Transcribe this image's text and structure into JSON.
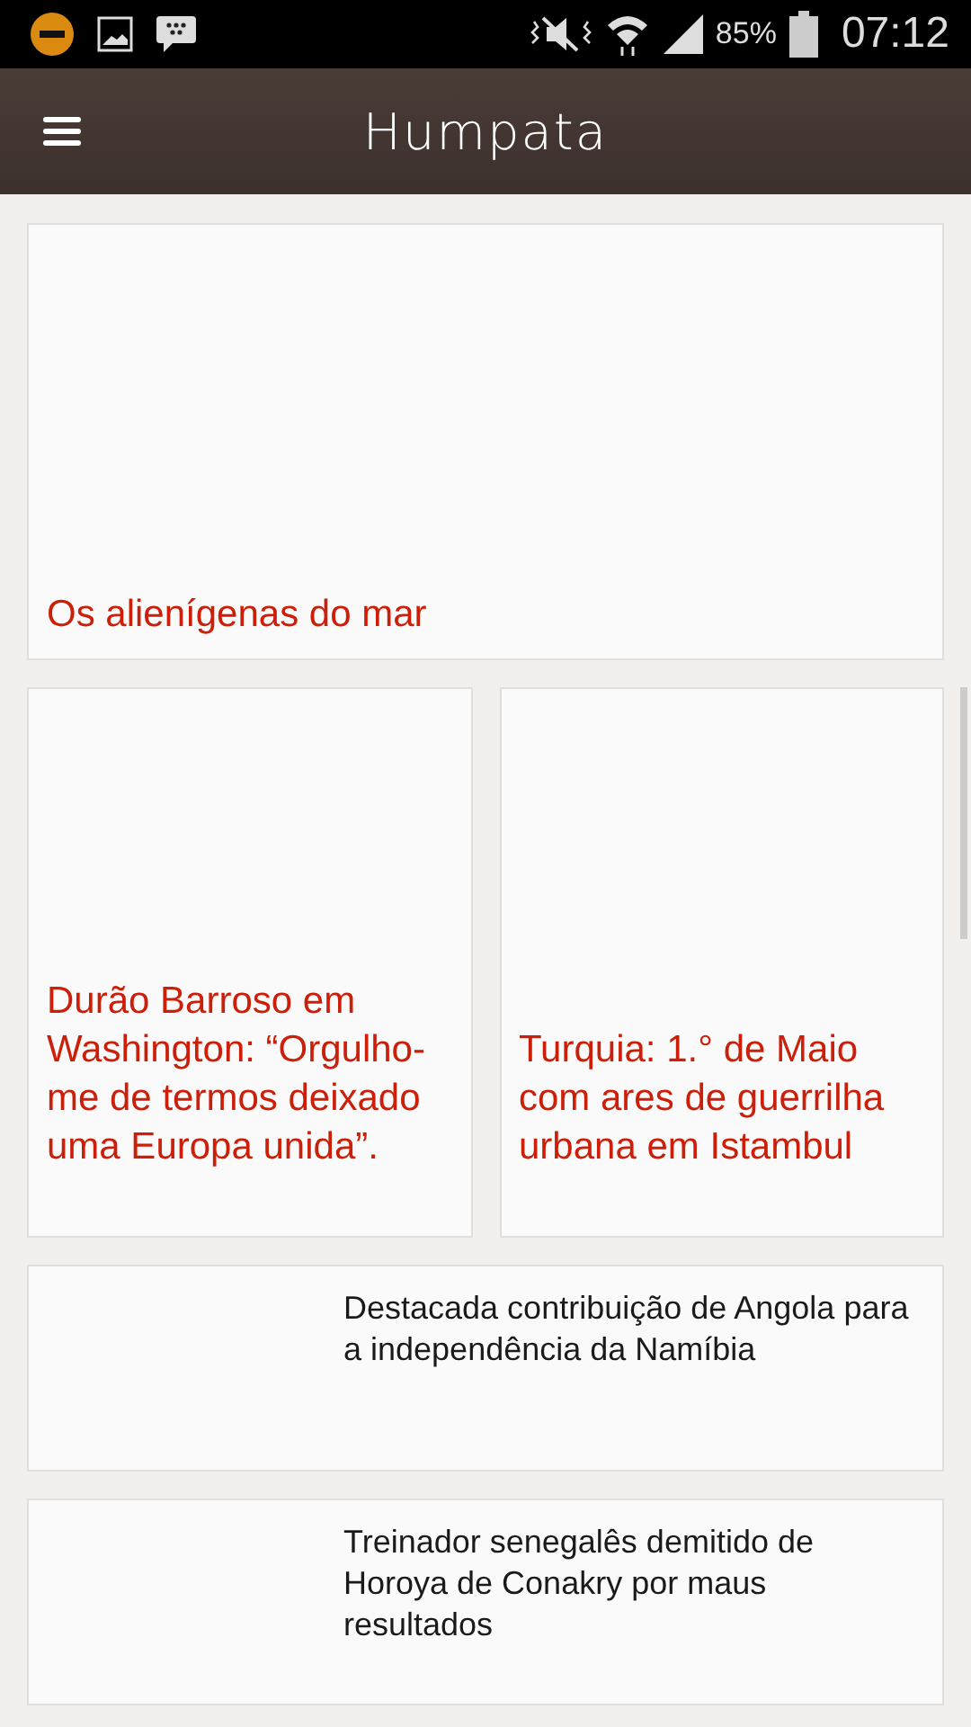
{
  "status_bar": {
    "battery": "85%",
    "time": "07:12"
  },
  "app_bar": {
    "title": "Humpata"
  },
  "articles": [
    {
      "kind": "featured",
      "title": "Os alienígenas do mar"
    },
    {
      "kind": "tile",
      "title": "Durão Barroso em Washington: “Orgulho-me de termos deixado uma Europa unida”."
    },
    {
      "kind": "tile",
      "title": "Turquia: 1.° de Maio com ares de guerrilha urbana em Istambul"
    },
    {
      "kind": "row",
      "title": "Destacada contribuição de Angola para a independência da Namíbia"
    },
    {
      "kind": "row",
      "title": "Treinador senegalês demitido de Horoya de Conakry por maus resultados"
    }
  ]
}
